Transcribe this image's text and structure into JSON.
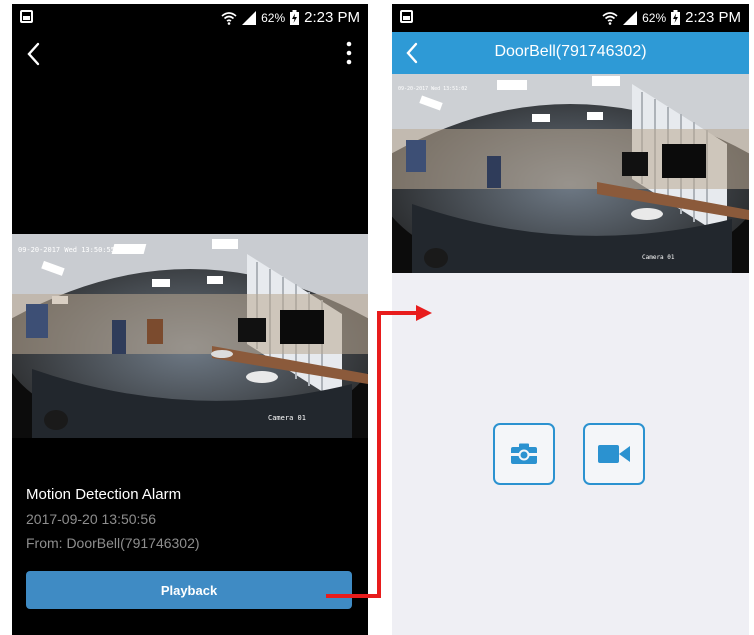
{
  "status_bar": {
    "battery_percent": "62%",
    "time": "2:23 PM"
  },
  "left_screen": {
    "camera_osd": {
      "timestamp": "09-20-2017 Wed 13:50:55",
      "camera_label": "Camera 01"
    },
    "alarm": {
      "title": "Motion Detection Alarm",
      "datetime": "2017-09-20 13:50:56",
      "source": "From: DoorBell(791746302)"
    },
    "playback_label": "Playback"
  },
  "right_screen": {
    "title": "DoorBell(791746302)",
    "camera_osd": {
      "timestamp": "09-20-2017 Wed 13:51:02",
      "camera_label": "Camera 01"
    },
    "actions": [
      {
        "icon": "camera-snapshot-icon"
      },
      {
        "icon": "video-record-icon"
      }
    ]
  },
  "colors": {
    "header_blue": "#2e9ad6",
    "playback_blue": "#3f8bc4",
    "arrow_red": "#e81c1c",
    "action_border": "#2b92d0"
  }
}
